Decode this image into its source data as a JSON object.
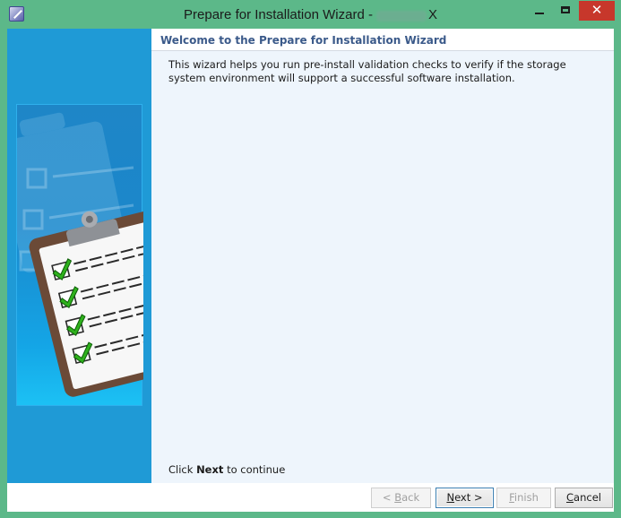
{
  "window": {
    "title": "Prepare for Installation Wizard -",
    "title_suffix": "X",
    "close_glyph": "✕",
    "icons": {
      "app": "wizard-app-icon",
      "minimize": "minimize-icon",
      "maximize": "maximize-icon",
      "close": "close-icon"
    }
  },
  "wizard": {
    "header_title": "Welcome to the Prepare for Installation Wizard",
    "description": "This wizard helps you run pre-install validation checks to verify if the storage system environment will support a successful software installation.",
    "footer_prefix": "Click",
    "footer_bold": "Next",
    "footer_suffix": "to continue",
    "illustration": "clipboard-checklist-illustration"
  },
  "buttons": {
    "back_prefix": "< ",
    "back_mnemonic": "B",
    "back_rest": "ack",
    "next_mnemonic": "N",
    "next_rest": "ext >",
    "finish_mnemonic": "F",
    "finish_rest": "inish",
    "cancel_mnemonic": "C",
    "cancel_rest": "ancel"
  },
  "colors": {
    "frame": "#5cb889",
    "close_button": "#c7372b",
    "side_panel": "#1f9ad6",
    "content_bg": "#eef5fc",
    "header_text": "#3b5a8a"
  }
}
